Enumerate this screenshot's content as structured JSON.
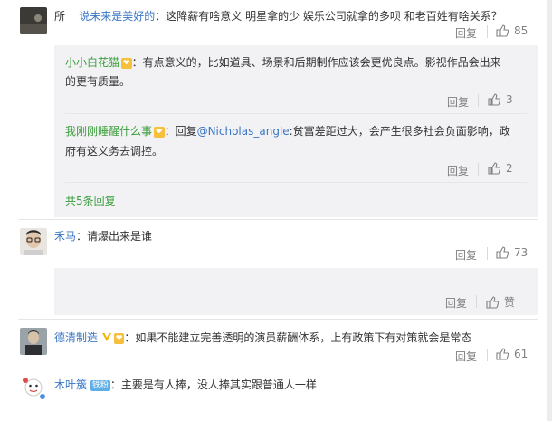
{
  "comments": [
    {
      "prefix": "所",
      "user": "说未来是美好的",
      "text": "：这降薪有啥意义  明星拿的少 娱乐公司就拿的多呗  和老百姓有啥关系？",
      "reply_label": "回复",
      "likes": "85"
    },
    {
      "user": "禾马",
      "text": "：请爆出来是谁",
      "reply_label": "回复",
      "likes": "73"
    },
    {
      "user": "德清制造",
      "text": "：如果不能建立完善透明的演员薪酬体系，上有政策下有对策就会是常态",
      "reply_label": "回复",
      "likes": "61"
    },
    {
      "user": "木叶簇",
      "badge": "铁粉",
      "text": "：主要是有人捧，没人捧其实跟普通人一样"
    }
  ],
  "replies": [
    {
      "user": "小小白花猫",
      "text_line1": "：有点意义的，比如道具、场景和后期制作应该会更优良点。影视作品会出来",
      "text_line2": "的更有质量。",
      "reply_label": "回复",
      "likes": "3"
    },
    {
      "user": "我刚刚睡醒什么事",
      "reply_word": "：回复",
      "mention": "@Nicholas_angle",
      "text_line1": ":贫富差距过大，会产生很多社会负面影响，政",
      "text_line2": "府有这义务去调控。",
      "reply_label": "回复",
      "likes": "2"
    }
  ],
  "more_replies": "共5条回复",
  "empty_reply_box": {
    "reply_label": "回复",
    "like_label": "赞"
  }
}
